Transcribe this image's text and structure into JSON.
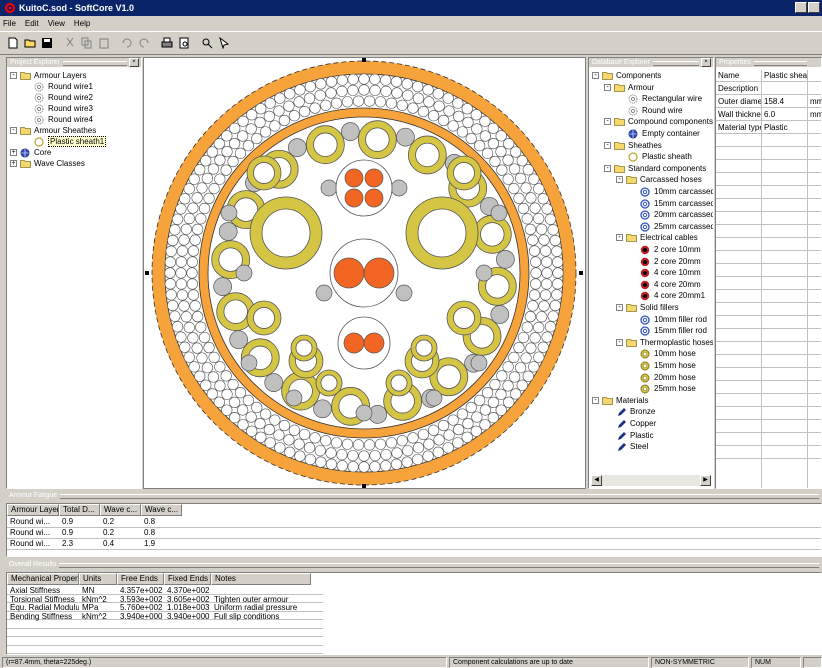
{
  "window": {
    "title": "KuitoC.sod - SoftCore V1.0"
  },
  "menu": [
    "File",
    "Edit",
    "View",
    "Help"
  ],
  "toolbar_icons": [
    "new-icon",
    "open-icon",
    "save-icon",
    "cut-icon",
    "copy-icon",
    "paste-icon",
    "undo-icon",
    "redo-icon",
    "print-icon",
    "print-preview-icon",
    "zoom-icon",
    "select-icon"
  ],
  "project_explorer": {
    "title": "Project Explorer",
    "items": [
      {
        "label": "Armour Layers",
        "level": 0,
        "icon": "folder",
        "exp": "-"
      },
      {
        "label": "Round wire1",
        "level": 1,
        "icon": "gear"
      },
      {
        "label": "Round wire2",
        "level": 1,
        "icon": "gear"
      },
      {
        "label": "Round wire3",
        "level": 1,
        "icon": "gear"
      },
      {
        "label": "Round wire4",
        "level": 1,
        "icon": "gear"
      },
      {
        "label": "Armour Sheathes",
        "level": 0,
        "icon": "folder",
        "exp": "-"
      },
      {
        "label": "Plastic sheath1",
        "level": 1,
        "icon": "ring",
        "selected": true
      },
      {
        "label": "Core",
        "level": 0,
        "icon": "globe",
        "exp": "+"
      },
      {
        "label": "Wave Classes",
        "level": 0,
        "icon": "folder",
        "exp": "+"
      }
    ]
  },
  "database_explorer": {
    "title": "Database Explorer",
    "items": [
      {
        "label": "Components",
        "level": 0,
        "icon": "folder",
        "exp": "-"
      },
      {
        "label": "Armour",
        "level": 1,
        "icon": "folder",
        "exp": "-"
      },
      {
        "label": "Rectangular wire",
        "level": 2,
        "icon": "gear"
      },
      {
        "label": "Round wire",
        "level": 2,
        "icon": "gear"
      },
      {
        "label": "Compound components",
        "level": 1,
        "icon": "folder",
        "exp": "-"
      },
      {
        "label": "Empty container",
        "level": 2,
        "icon": "globe"
      },
      {
        "label": "Sheathes",
        "level": 1,
        "icon": "folder",
        "exp": "-"
      },
      {
        "label": "Plastic sheath",
        "level": 2,
        "icon": "ring"
      },
      {
        "label": "Standard components",
        "level": 1,
        "icon": "folder",
        "exp": "-"
      },
      {
        "label": "Carcassed hoses",
        "level": 2,
        "icon": "folder",
        "exp": "-"
      },
      {
        "label": "10mm carcassed",
        "level": 3,
        "icon": "blue"
      },
      {
        "label": "15mm carcassed",
        "level": 3,
        "icon": "blue"
      },
      {
        "label": "20mm carcassed",
        "level": 3,
        "icon": "blue"
      },
      {
        "label": "25mm carcassed",
        "level": 3,
        "icon": "blue"
      },
      {
        "label": "Electrical cables",
        "level": 2,
        "icon": "folder",
        "exp": "-"
      },
      {
        "label": "2 core 10mm",
        "level": 3,
        "icon": "red"
      },
      {
        "label": "2 core 20mm",
        "level": 3,
        "icon": "red"
      },
      {
        "label": "4 core 10mm",
        "level": 3,
        "icon": "red"
      },
      {
        "label": "4 core 20mm",
        "level": 3,
        "icon": "red"
      },
      {
        "label": "4 core 20mm1",
        "level": 3,
        "icon": "red"
      },
      {
        "label": "Solid fillers",
        "level": 2,
        "icon": "folder",
        "exp": "-"
      },
      {
        "label": "10mm filler rod",
        "level": 3,
        "icon": "blue"
      },
      {
        "label": "15mm filler rod",
        "level": 3,
        "icon": "blue"
      },
      {
        "label": "Thermoplastic hoses",
        "level": 2,
        "icon": "folder",
        "exp": "-"
      },
      {
        "label": "10mm hose",
        "level": 3,
        "icon": "olive"
      },
      {
        "label": "15mm hose",
        "level": 3,
        "icon": "olive"
      },
      {
        "label": "20mm hose",
        "level": 3,
        "icon": "olive"
      },
      {
        "label": "25mm hose",
        "level": 3,
        "icon": "olive"
      },
      {
        "label": "Materials",
        "level": 0,
        "icon": "folder",
        "exp": "-"
      },
      {
        "label": "Bronze",
        "level": 1,
        "icon": "pen"
      },
      {
        "label": "Copper",
        "level": 1,
        "icon": "pen"
      },
      {
        "label": "Plastic",
        "level": 1,
        "icon": "pen"
      },
      {
        "label": "Steel",
        "level": 1,
        "icon": "pen"
      }
    ]
  },
  "properties": {
    "title": "Properties",
    "rows": [
      {
        "name": "Name",
        "value": "Plastic sheath",
        "unit": ""
      },
      {
        "name": "Description",
        "value": "",
        "unit": ""
      },
      {
        "name": "Outer diamete",
        "value": "158.4",
        "unit": "mm"
      },
      {
        "name": "Wall thicknes",
        "value": "6.0",
        "unit": "mm"
      },
      {
        "name": "Material type",
        "value": "Plastic",
        "unit": ""
      }
    ]
  },
  "armour_fatigue": {
    "title": "Armour Fatigue",
    "columns": [
      "Armour Layer",
      "Total D...",
      "Wave c...",
      "Wave c..."
    ],
    "rows": [
      [
        "Round wi...",
        "0.9",
        "0.2",
        "0.8"
      ],
      [
        "Round wi...",
        "0.9",
        "0.2",
        "0.8"
      ],
      [
        "Round wi...",
        "2.3",
        "0.4",
        "1.9"
      ]
    ]
  },
  "overall_results": {
    "title": "Overall Results",
    "columns": [
      "Mechanical Property",
      "Units",
      "Free Ends",
      "Fixed Ends",
      "Notes"
    ],
    "rows": [
      [
        "Axial Stiffness",
        "MN",
        "4.357e+002",
        "4.370e+002",
        ""
      ],
      [
        "Torsional Stiffness",
        "kNm^2",
        "3.593e+002",
        "3.605e+002",
        "Tighten outer armour"
      ],
      [
        "Equ. Radial Modulus",
        "MPa",
        "5.760e+002",
        "1.018e+003",
        "Uniform radial pressure"
      ],
      [
        "Bending Stiffness",
        "kNm^2",
        "3.940e+000",
        "3.940e+000",
        "Full slip conditions"
      ]
    ]
  },
  "status": {
    "coords": "(r=87.4mm, theta=225deg.)",
    "message": "Component calculations are up to date",
    "mode": "NON-SYMMETRIC",
    "num": "NUM"
  },
  "colors": {
    "orange": "#f7a33b",
    "olive": "#d4c545",
    "red": "#f26522",
    "gray": "#c0c0c0"
  }
}
